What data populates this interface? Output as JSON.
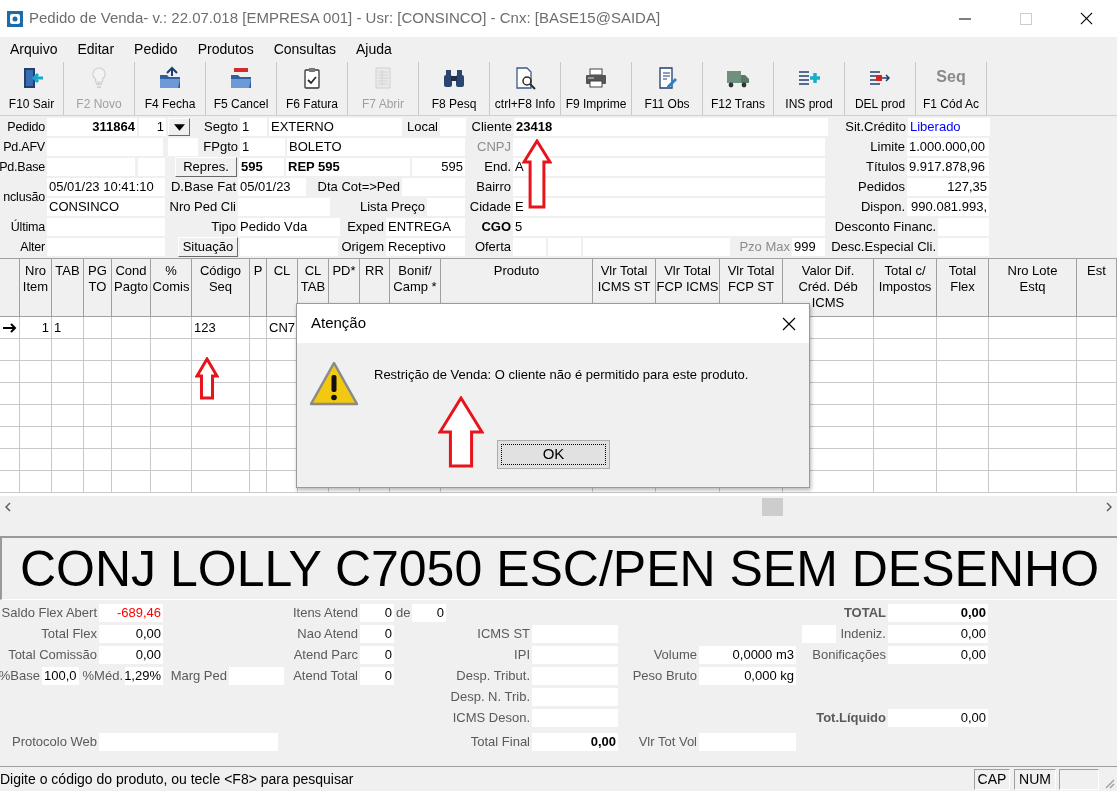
{
  "window": {
    "title": "Pedido de Venda- v.: 22.07.018 [EMPRESA 001] - Usr: [CONSINCO] - Cnx: [BASE15@SAIDA]"
  },
  "menu": [
    "Arquivo",
    "Editar",
    "Pedido",
    "Produtos",
    "Consultas",
    "Ajuda"
  ],
  "toolbar": [
    {
      "label": "F10 Sair",
      "disabled": false
    },
    {
      "label": "F2 Novo",
      "disabled": true
    },
    {
      "label": "F4 Fecha",
      "disabled": false
    },
    {
      "label": "F5 Cancel",
      "disabled": false
    },
    {
      "label": "F6 Fatura",
      "disabled": false
    },
    {
      "label": "F7 Abrir",
      "disabled": true
    },
    {
      "label": "F8 Pesq",
      "disabled": false
    },
    {
      "label": "ctrl+F8 Info",
      "disabled": false
    },
    {
      "label": "F9 Imprime",
      "disabled": false
    },
    {
      "label": "F11 Obs",
      "disabled": false
    },
    {
      "label": "F12 Trans",
      "disabled": false
    },
    {
      "label": "INS prod",
      "disabled": false
    },
    {
      "label": "DEL prod",
      "disabled": false
    },
    {
      "label": "F1 Cód Ac",
      "caption": "Seq",
      "disabled": false
    }
  ],
  "header": {
    "left_labels": [
      "Pedido",
      "Pd.AFV",
      "Pd.Base",
      "nclusão",
      "Última",
      "Alter"
    ],
    "fields": [
      {
        "kind": "fieldbold",
        "text": "311864"
      },
      {
        "kind": "field",
        "text": "1"
      },
      {
        "kind": "dropdown"
      },
      {
        "kind": "label",
        "text": "Segto"
      },
      {
        "kind": "field",
        "text": "1"
      },
      {
        "kind": "field",
        "text": "EXTERNO"
      },
      {
        "kind": "label",
        "text": "Local"
      },
      {
        "kind": "field"
      },
      {
        "kind": "label",
        "text": "Cliente"
      },
      {
        "kind": "fieldbold",
        "text": "23418"
      },
      {
        "kind": "label",
        "text": "Sit.Crédito"
      },
      {
        "kind": "fieldblue",
        "text": "Liberado"
      },
      {
        "kind": "field"
      },
      {
        "kind": "field"
      },
      {
        "kind": "label",
        "text": "FPgto"
      },
      {
        "kind": "field",
        "text": "1"
      },
      {
        "kind": "field",
        "text": "BOLETO"
      },
      {
        "kind": "labeldim",
        "text": "CNPJ"
      },
      {
        "kind": "field"
      },
      {
        "kind": "label",
        "text": "Limite"
      },
      {
        "kind": "field",
        "text": "1.000.000,00"
      },
      {
        "kind": "field"
      },
      {
        "kind": "field"
      },
      {
        "kind": "button",
        "text": "Repres."
      },
      {
        "kind": "fieldbold",
        "text": "595"
      },
      {
        "kind": "fieldbold",
        "text": "REP 595"
      },
      {
        "kind": "field",
        "text": "595"
      },
      {
        "kind": "label",
        "text": "End."
      },
      {
        "kind": "field",
        "text": "A"
      },
      {
        "kind": "label",
        "text": "Títulos"
      },
      {
        "kind": "field",
        "text": "9.917.878,96"
      },
      {
        "kind": "field",
        "text": "05/01/23 10:41:10"
      },
      {
        "kind": "label",
        "text": "D.Base Fat"
      },
      {
        "kind": "field",
        "text": "05/01/23"
      },
      {
        "kind": "label",
        "text": "Dta Cot=>Ped"
      },
      {
        "kind": "field"
      },
      {
        "kind": "label",
        "text": "Bairro"
      },
      {
        "kind": "field"
      },
      {
        "kind": "label",
        "text": "Pedidos"
      },
      {
        "kind": "field",
        "text": "127,35"
      },
      {
        "kind": "field",
        "text": "CONSINCO"
      },
      {
        "kind": "label",
        "text": "Nro Ped Cli"
      },
      {
        "kind": "field"
      },
      {
        "kind": "label",
        "text": "Lista Preço"
      },
      {
        "kind": "field"
      },
      {
        "kind": "label",
        "text": "Cidade"
      },
      {
        "kind": "field",
        "text": "E"
      },
      {
        "kind": "label",
        "text": "Dispon."
      },
      {
        "kind": "field",
        "text": "990.081.993,"
      },
      {
        "kind": "field"
      },
      {
        "kind": "label",
        "text": "Tipo"
      },
      {
        "kind": "field",
        "text": "Pedido Vda"
      },
      {
        "kind": "label",
        "text": "Exped"
      },
      {
        "kind": "field",
        "text": "ENTREGA"
      },
      {
        "kind": "labelbold",
        "text": "CGO"
      },
      {
        "kind": "field",
        "text": "5"
      },
      {
        "kind": "label",
        "text": "Desconto Financ."
      },
      {
        "kind": "field"
      },
      {
        "kind": "field"
      },
      {
        "kind": "button",
        "text": "Situação"
      },
      {
        "kind": "field"
      },
      {
        "kind": "label",
        "text": "Origem"
      },
      {
        "kind": "field",
        "text": "Receptivo"
      },
      {
        "kind": "label",
        "text": "Oferta"
      },
      {
        "kind": "field"
      },
      {
        "kind": "field"
      },
      {
        "kind": "field"
      },
      {
        "kind": "labeldim",
        "text": "Pzo Max"
      },
      {
        "kind": "field",
        "text": "999"
      },
      {
        "kind": "label",
        "text": "Desc.Especial Cli."
      },
      {
        "kind": "field"
      }
    ]
  },
  "grid": {
    "columns": [
      "Nro\nItem",
      "TAB",
      "PG\nTO",
      "Cond\nPagto",
      "%\nComis",
      "Código\nSeq",
      "P",
      "CL",
      "CL\nTAB",
      "PD*",
      "RR",
      "Bonif/\nCamp *",
      "Produto",
      "Vlr Total\nICMS ST",
      "Vlr Total\nFCP ICMS",
      "Vlr Total\nFCP ST",
      "Valor Dif.\nCréd. Déb\nICMS",
      "Total c/\nImpostos",
      "Total\nFlex",
      "Nro Lote\nEstq",
      "Est"
    ],
    "rows": [
      {
        "selected": true,
        "cells": {
          "nro_item": "1",
          "tab": "1",
          "codigo_seq": "123",
          "cl": "CN7"
        }
      }
    ]
  },
  "product_name": "CONJ LOLLY C7050 ESC/PEN SEM DESENHO",
  "totals": {
    "fields": [
      {
        "kind": "label",
        "text": "Saldo Flex Abert"
      },
      {
        "kind": "fieldred",
        "text": "-689,46"
      },
      {
        "kind": "label",
        "text": "Itens Atend"
      },
      {
        "kind": "field",
        "text": "0"
      },
      {
        "kind": "label",
        "text": "de"
      },
      {
        "kind": "field",
        "text": "0"
      },
      {
        "kind": "labelbold",
        "text": "TOTAL"
      },
      {
        "kind": "fieldbold",
        "text": "0,00"
      },
      {
        "kind": "label",
        "text": "Total Flex"
      },
      {
        "kind": "field",
        "text": "0,00"
      },
      {
        "kind": "label",
        "text": "Nao Atend"
      },
      {
        "kind": "field",
        "text": "0"
      },
      {
        "kind": "label",
        "text": "ICMS ST"
      },
      {
        "kind": "field"
      },
      {
        "kind": "field"
      },
      {
        "kind": "label",
        "text": "Indeniz."
      },
      {
        "kind": "field",
        "text": "0,00"
      },
      {
        "kind": "label",
        "text": "Total Comissão"
      },
      {
        "kind": "field",
        "text": "0,00"
      },
      {
        "kind": "label",
        "text": "Atend Parc"
      },
      {
        "kind": "field",
        "text": "0"
      },
      {
        "kind": "label",
        "text": "IPI"
      },
      {
        "kind": "field"
      },
      {
        "kind": "label",
        "text": "Volume"
      },
      {
        "kind": "field",
        "text": "0,0000 m3"
      },
      {
        "kind": "label",
        "text": "Bonificações"
      },
      {
        "kind": "field",
        "text": "0,00"
      },
      {
        "kind": "label",
        "text": "%Base"
      },
      {
        "kind": "field",
        "text": "100,0"
      },
      {
        "kind": "label",
        "text": "%Méd."
      },
      {
        "kind": "field",
        "text": "1,29%"
      },
      {
        "kind": "label",
        "text": "Marg Ped"
      },
      {
        "kind": "field"
      },
      {
        "kind": "label",
        "text": "Atend Total"
      },
      {
        "kind": "field",
        "text": "0"
      },
      {
        "kind": "label",
        "text": "Desp. Tribut."
      },
      {
        "kind": "field"
      },
      {
        "kind": "label",
        "text": "Peso Bruto"
      },
      {
        "kind": "field",
        "text": "0,000 kg"
      },
      {
        "kind": "label",
        "text": "Desp. N. Trib."
      },
      {
        "kind": "field"
      },
      {
        "kind": "label",
        "text": "ICMS Deson."
      },
      {
        "kind": "field"
      },
      {
        "kind": "labelbold",
        "text": "Tot.Líquido"
      },
      {
        "kind": "field",
        "text": "0,00"
      },
      {
        "kind": "label",
        "text": "Protocolo Web"
      },
      {
        "kind": "field"
      },
      {
        "kind": "label",
        "text": "Total Final"
      },
      {
        "kind": "fieldbold",
        "text": "0,00"
      },
      {
        "kind": "label",
        "text": "Vlr Tot Vol"
      },
      {
        "kind": "field"
      }
    ]
  },
  "status_bar": {
    "message": "Digite o código do produto, ou tecle <F8> para pesquisar",
    "indicators": [
      "CAP",
      "NUM"
    ]
  },
  "dialog": {
    "title": "Atenção",
    "message": "Restrição de Venda: O cliente não é permitido para este produto.",
    "button": "OK"
  }
}
